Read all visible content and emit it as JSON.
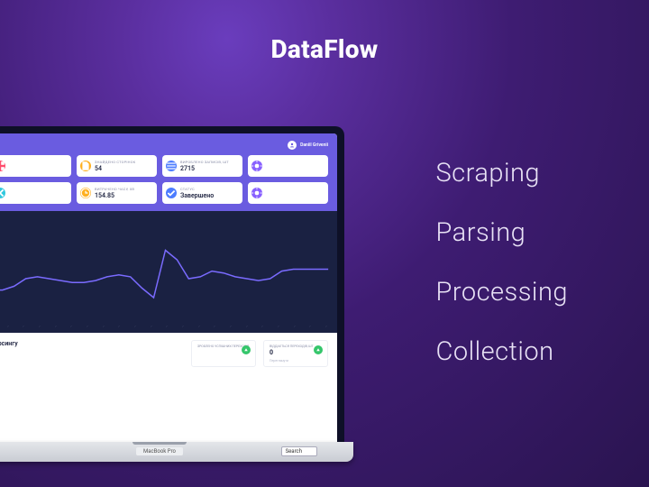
{
  "brand": "DataFlow",
  "features": [
    "Scraping",
    "Parsing",
    "Processing",
    "Collection"
  ],
  "device_label": "MacBook Pro",
  "search_label": "Search",
  "user": {
    "name": "Daniil Grivenii"
  },
  "stats": [
    {
      "label": "",
      "value": "",
      "icon": "grid",
      "color": "red"
    },
    {
      "label": "ЗНАЙДЕНО СТОРІНОК",
      "value": "54",
      "icon": "file",
      "color": "orange"
    },
    {
      "label": "ВИРОБЛЕНО ЗАПИСІВ, ШТ",
      "value": "2715",
      "icon": "list",
      "color": "blue"
    },
    {
      "label": "",
      "value": "",
      "icon": "gear",
      "color": "purple"
    },
    {
      "label": "",
      "value": "",
      "icon": "x",
      "color": "cyan"
    },
    {
      "label": "ВИТРАЧЕНО ЧАСУ, ХВ",
      "value": "154.85",
      "icon": "clock",
      "color": "orange"
    },
    {
      "label": "СТАТУС",
      "value": "Завершено",
      "icon": "check",
      "color": "blue"
    },
    {
      "label": "",
      "value": "",
      "icon": "gear",
      "color": "purple"
    }
  ],
  "section_title": "парсингу",
  "mini": [
    {
      "label": "ЗРОБЛЕНО УСПІШНИХ ПЕРЕХОДІВ",
      "value": "",
      "sub": ""
    },
    {
      "label": "ВІДДАЄТЬСЯ ПЕРЕХОДІВ, ШТ",
      "value": "0",
      "sub": "Переглянути"
    }
  ],
  "chart_data": {
    "type": "line",
    "x": [
      0,
      1,
      2,
      3,
      4,
      5,
      6,
      7,
      8,
      9,
      10,
      11,
      12,
      13,
      14,
      15,
      16,
      17,
      18,
      19,
      20,
      21,
      22,
      23,
      24,
      25,
      26,
      27,
      28,
      29
    ],
    "values": [
      28,
      28,
      32,
      40,
      42,
      40,
      38,
      36,
      36,
      38,
      42,
      44,
      42,
      30,
      20,
      70,
      60,
      40,
      42,
      48,
      46,
      42,
      40,
      38,
      40,
      48,
      50,
      50,
      50,
      50
    ],
    "ylim": [
      0,
      100
    ]
  }
}
